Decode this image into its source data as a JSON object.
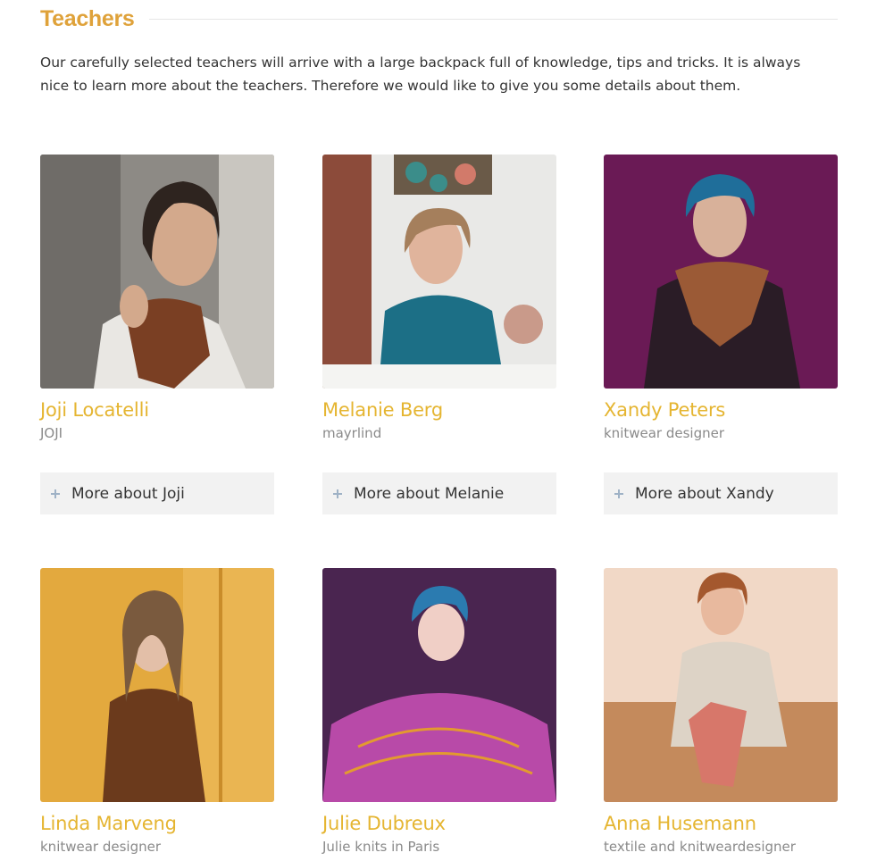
{
  "section": {
    "title": "Teachers",
    "intro": "Our carefully selected teachers will arrive with a large backpack full of knowledge, tips and tricks. It is always nice to learn more about the teachers. Therefore we would like to give you some details about them."
  },
  "teachers": [
    {
      "name": "Joji Locatelli",
      "role": "JOJI",
      "more_label": "More about Joji"
    },
    {
      "name": "Melanie Berg",
      "role": "mayrlind",
      "more_label": "More about Melanie"
    },
    {
      "name": "Xandy Peters",
      "role": "knitwear designer",
      "more_label": "More about Xandy"
    },
    {
      "name": "Linda Marveng",
      "role": "knitwear designer"
    },
    {
      "name": "Julie Dubreux",
      "role": "Julie knits in Paris"
    },
    {
      "name": "Anna Husemann",
      "role": "textile and knitweardesigner"
    }
  ],
  "colors": {
    "accent": "#dfa23a",
    "name": "#e5b531",
    "muted": "#8a8a8a",
    "button_bg": "#f2f2f2",
    "plus_icon": "#9fb2c6"
  }
}
